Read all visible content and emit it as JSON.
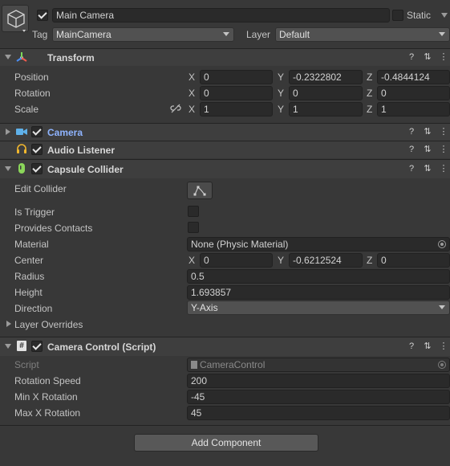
{
  "header": {
    "name": "Main Camera",
    "static_label": "Static",
    "tag_label": "Tag",
    "tag_value": "MainCamera",
    "layer_label": "Layer",
    "layer_value": "Default"
  },
  "transform": {
    "title": "Transform",
    "rows": [
      {
        "label": "Position",
        "x": "0",
        "y": "-0.2322802",
        "z": "-0.4844124"
      },
      {
        "label": "Rotation",
        "x": "0",
        "y": "0",
        "z": "0"
      },
      {
        "label": "Scale",
        "x": "1",
        "y": "1",
        "z": "1"
      }
    ],
    "axis": {
      "x": "X",
      "y": "Y",
      "z": "Z"
    }
  },
  "camera": {
    "title": "Camera"
  },
  "audio_listener": {
    "title": "Audio Listener"
  },
  "capsule_collider": {
    "title": "Capsule Collider",
    "edit_collider": "Edit Collider",
    "is_trigger": "Is Trigger",
    "provides_contacts": "Provides Contacts",
    "material_label": "Material",
    "material_value": "None (Physic Material)",
    "center_label": "Center",
    "center": {
      "x": "0",
      "y": "-0.6212524",
      "z": "0"
    },
    "radius_label": "Radius",
    "radius_value": "0.5",
    "height_label": "Height",
    "height_value": "1.693857",
    "direction_label": "Direction",
    "direction_value": "Y-Axis",
    "layer_overrides": "Layer Overrides"
  },
  "camera_control": {
    "title": "Camera Control (Script)",
    "script_label": "Script",
    "script_value": "CameraControl",
    "rotation_speed_label": "Rotation Speed",
    "rotation_speed_value": "200",
    "min_x_label": "Min X Rotation",
    "min_x_value": "-45",
    "max_x_label": "Max X Rotation",
    "max_x_value": "45"
  },
  "add_component": "Add Component",
  "colors": {
    "camera_title": "#8fb4ff",
    "accent": "#3a79bb"
  }
}
